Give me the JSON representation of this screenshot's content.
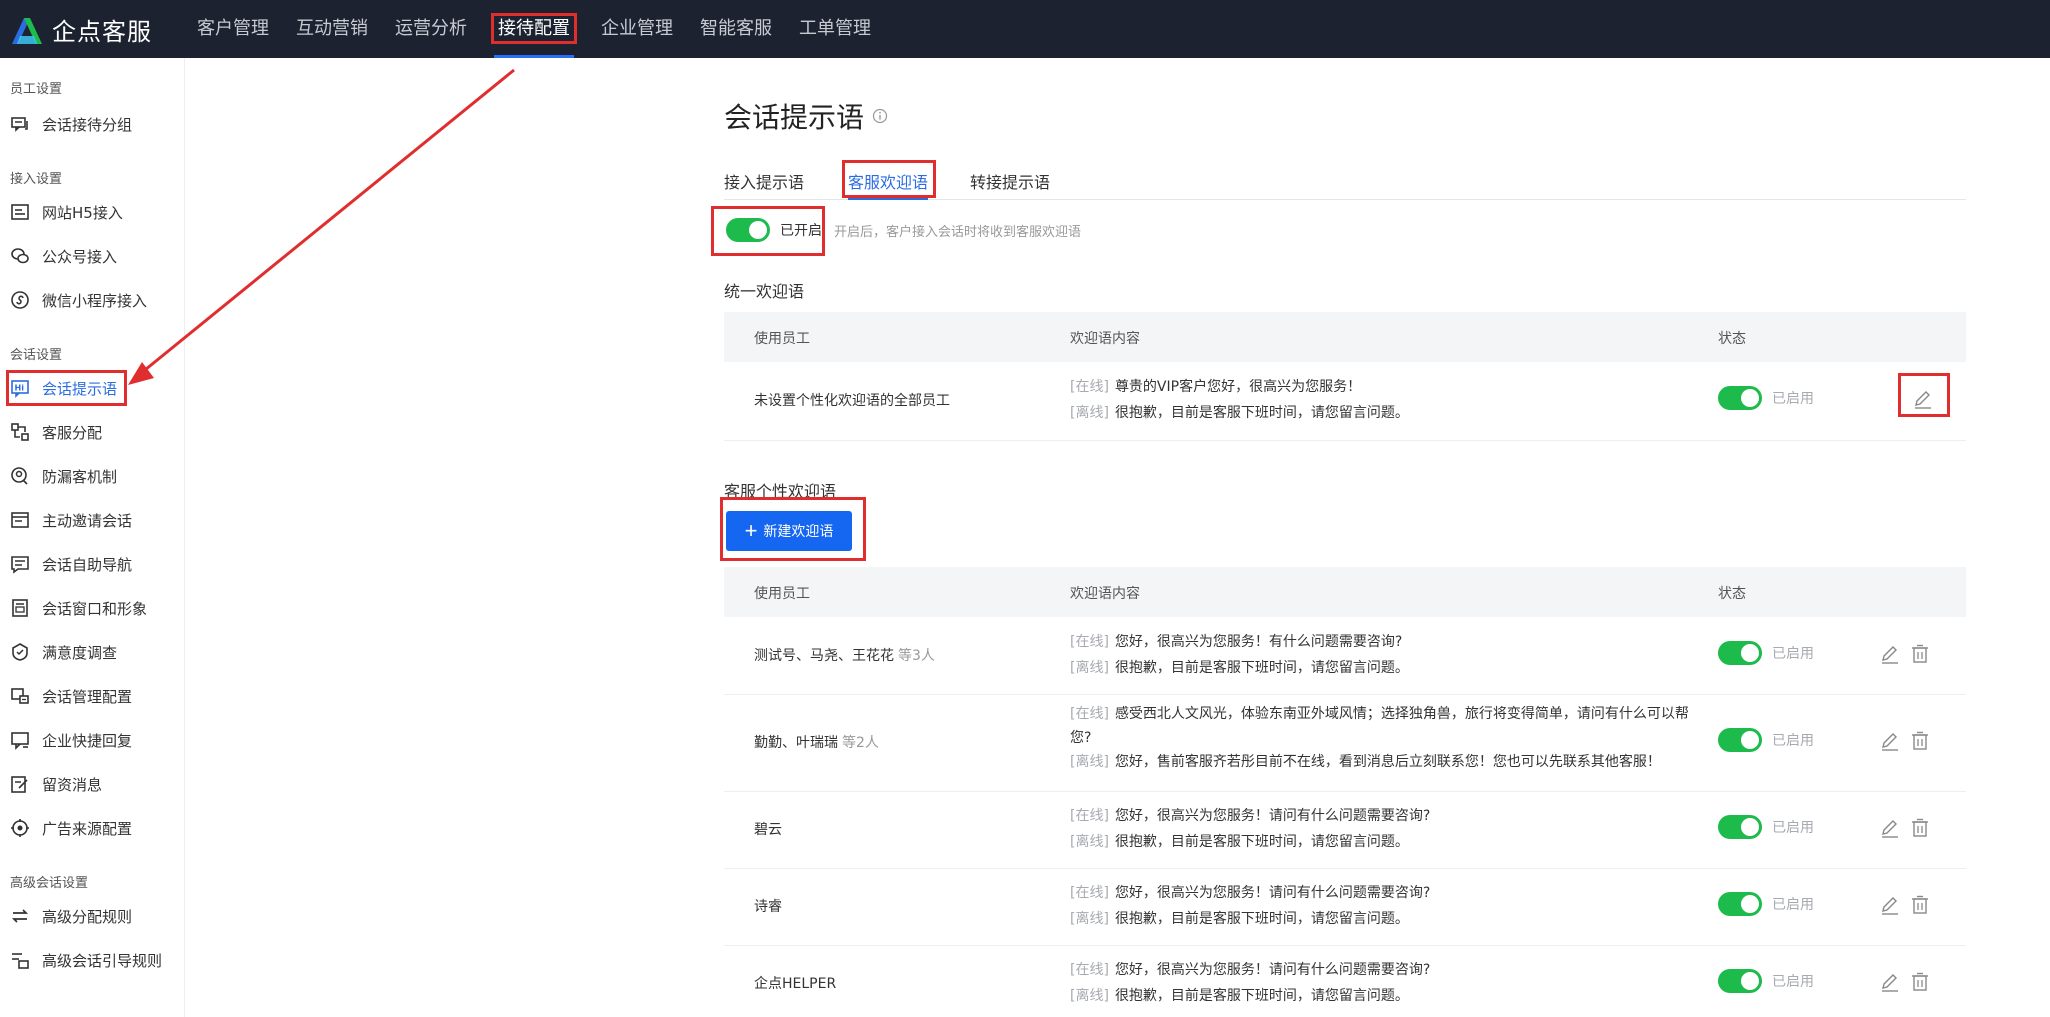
{
  "brand": {
    "name": "企点客服"
  },
  "nav": {
    "items": [
      "客户管理",
      "互动营销",
      "运营分析",
      "接待配置",
      "企业管理",
      "智能客服",
      "工单管理"
    ],
    "active_index": 3
  },
  "sidebar": {
    "sections": [
      {
        "title": "员工设置",
        "items": [
          "会话接待分组"
        ]
      },
      {
        "title": "接入设置",
        "items": [
          "网站H5接入",
          "公众号接入",
          "微信小程序接入"
        ]
      },
      {
        "title": "会话设置",
        "items": [
          "会话提示语",
          "客服分配",
          "防漏客机制",
          "主动邀请会话",
          "会话自助导航",
          "会话窗口和形象",
          "满意度调查",
          "会话管理配置",
          "企业快捷回复",
          "留资消息",
          "广告来源配置"
        ]
      },
      {
        "title": "高级会话设置",
        "items": [
          "高级分配规则",
          "高级会话引导规则"
        ]
      }
    ],
    "active_item": "会话提示语"
  },
  "page": {
    "title": "会话提示语",
    "tabs": [
      "接入提示语",
      "客服欢迎语",
      "转接提示语"
    ],
    "active_tab": 1,
    "switch": {
      "label": "已开启",
      "tip": "开启后，客户接入会话时将收到客服欢迎语"
    },
    "unified": {
      "title": "统一欢迎语",
      "columns": [
        "使用员工",
        "欢迎语内容",
        "状态"
      ],
      "row": {
        "user": "未设置个性化欢迎语的全部员工",
        "online_tag": "[在线]",
        "online": "尊贵的VIP客户您好，很高兴为您服务！",
        "offline_tag": "[离线]",
        "offline": "很抱歉，目前是客服下班时间，请您留言问题。",
        "status": "已启用"
      }
    },
    "personal": {
      "title": "客服个性欢迎语",
      "new_button": "新建欢迎语",
      "columns": [
        "使用员工",
        "欢迎语内容",
        "状态"
      ],
      "rows": [
        {
          "user": "测试号、马尧、王花花",
          "more": "等3人",
          "online_tag": "[在线]",
          "online": "您好，很高兴为您服务！有什么问题需要咨询?",
          "offline_tag": "[离线]",
          "offline": "很抱歉，目前是客服下班时间，请您留言问题。",
          "status": "已启用"
        },
        {
          "user": "勤勤、叶瑞瑞",
          "more": "等2人",
          "online_tag": "[在线]",
          "online": "感受西北人文风光，体验东南亚外域风情；选择独角兽，旅行将变得简单，请问有什么可以帮您?",
          "offline_tag": "[离线]",
          "offline": "您好，售前客服齐若彤目前不在线，看到消息后立刻联系您！您也可以先联系其他客服！",
          "status": "已启用"
        },
        {
          "user": "碧云",
          "more": "",
          "online_tag": "[在线]",
          "online": "您好，很高兴为您服务！请问有什么问题需要咨询?",
          "offline_tag": "[离线]",
          "offline": "很抱歉，目前是客服下班时间，请您留言问题。",
          "status": "已启用"
        },
        {
          "user": "诗睿",
          "more": "",
          "online_tag": "[在线]",
          "online": "您好，很高兴为您服务！请问有什么问题需要咨询?",
          "offline_tag": "[离线]",
          "offline": "很抱歉，目前是客服下班时间，请您留言问题。",
          "status": "已启用"
        },
        {
          "user": "企点HELPER",
          "more": "",
          "online_tag": "[在线]",
          "online": "您好，很高兴为您服务！请问有什么问题需要咨询?",
          "offline_tag": "[离线]",
          "offline": "很抱歉，目前是客服下班时间，请您留言问题。",
          "status": "已启用"
        }
      ]
    }
  },
  "colors": {
    "topbar": "#1d2230",
    "accent": "#2b6de0",
    "toggle_on": "#1dbb4b",
    "primary_button": "#1566f0",
    "annotation": "#e02d2d"
  },
  "icons": {
    "edit": "pencil-icon",
    "delete": "trash-icon",
    "info": "info-icon"
  }
}
